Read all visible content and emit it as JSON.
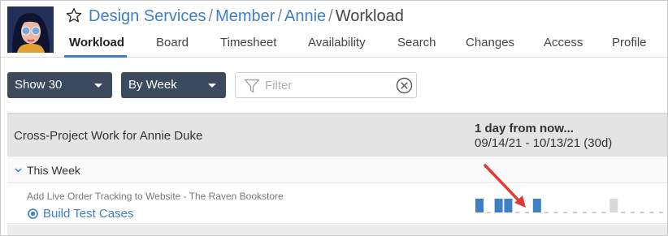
{
  "breadcrumb": {
    "links": [
      "Design Services",
      "Member",
      "Annie"
    ],
    "separator": "/",
    "current": "Workload"
  },
  "tabs": [
    {
      "label": "Workload",
      "active": true
    },
    {
      "label": "Board",
      "active": false
    },
    {
      "label": "Timesheet",
      "active": false
    },
    {
      "label": "Availability",
      "active": false
    },
    {
      "label": "Search",
      "active": false
    },
    {
      "label": "Changes",
      "active": false
    },
    {
      "label": "Access",
      "active": false
    },
    {
      "label": "Profile",
      "active": false
    }
  ],
  "toolbar": {
    "show_select": "Show 30",
    "period_select": "By Week",
    "filter_placeholder": "Filter",
    "filter_value": ""
  },
  "grid": {
    "title": "Cross-Project Work for Annie Duke",
    "range_title": "1 day from now...",
    "range_dates": "09/14/21 - 10/13/21 (30d)"
  },
  "group": {
    "label": "This Week",
    "expanded": true
  },
  "task": {
    "project": "Add Live Order Tracking to Website - The Raven Bookstore",
    "name": "Build Test Cases",
    "workload_days": [
      "work",
      "none",
      "work",
      "work",
      "none",
      "none",
      "work",
      "none",
      "none",
      "none",
      "none",
      "none",
      "none",
      "none",
      "off",
      "none",
      "none",
      "none",
      "none",
      "none"
    ]
  },
  "colors": {
    "accent": "#3f7fc4",
    "dropdown_bg": "#3b4a5e",
    "workload_bar": "#3f7fc4",
    "day_off": "#d8d8d8",
    "arrow": "#e03a35"
  },
  "icons": {
    "favorite": "star-outline-icon",
    "filter": "funnel-icon",
    "clear": "close-circle-icon",
    "expand": "chevron-down-icon",
    "status": "radio-circle-icon",
    "annotation": "red-arrow"
  }
}
